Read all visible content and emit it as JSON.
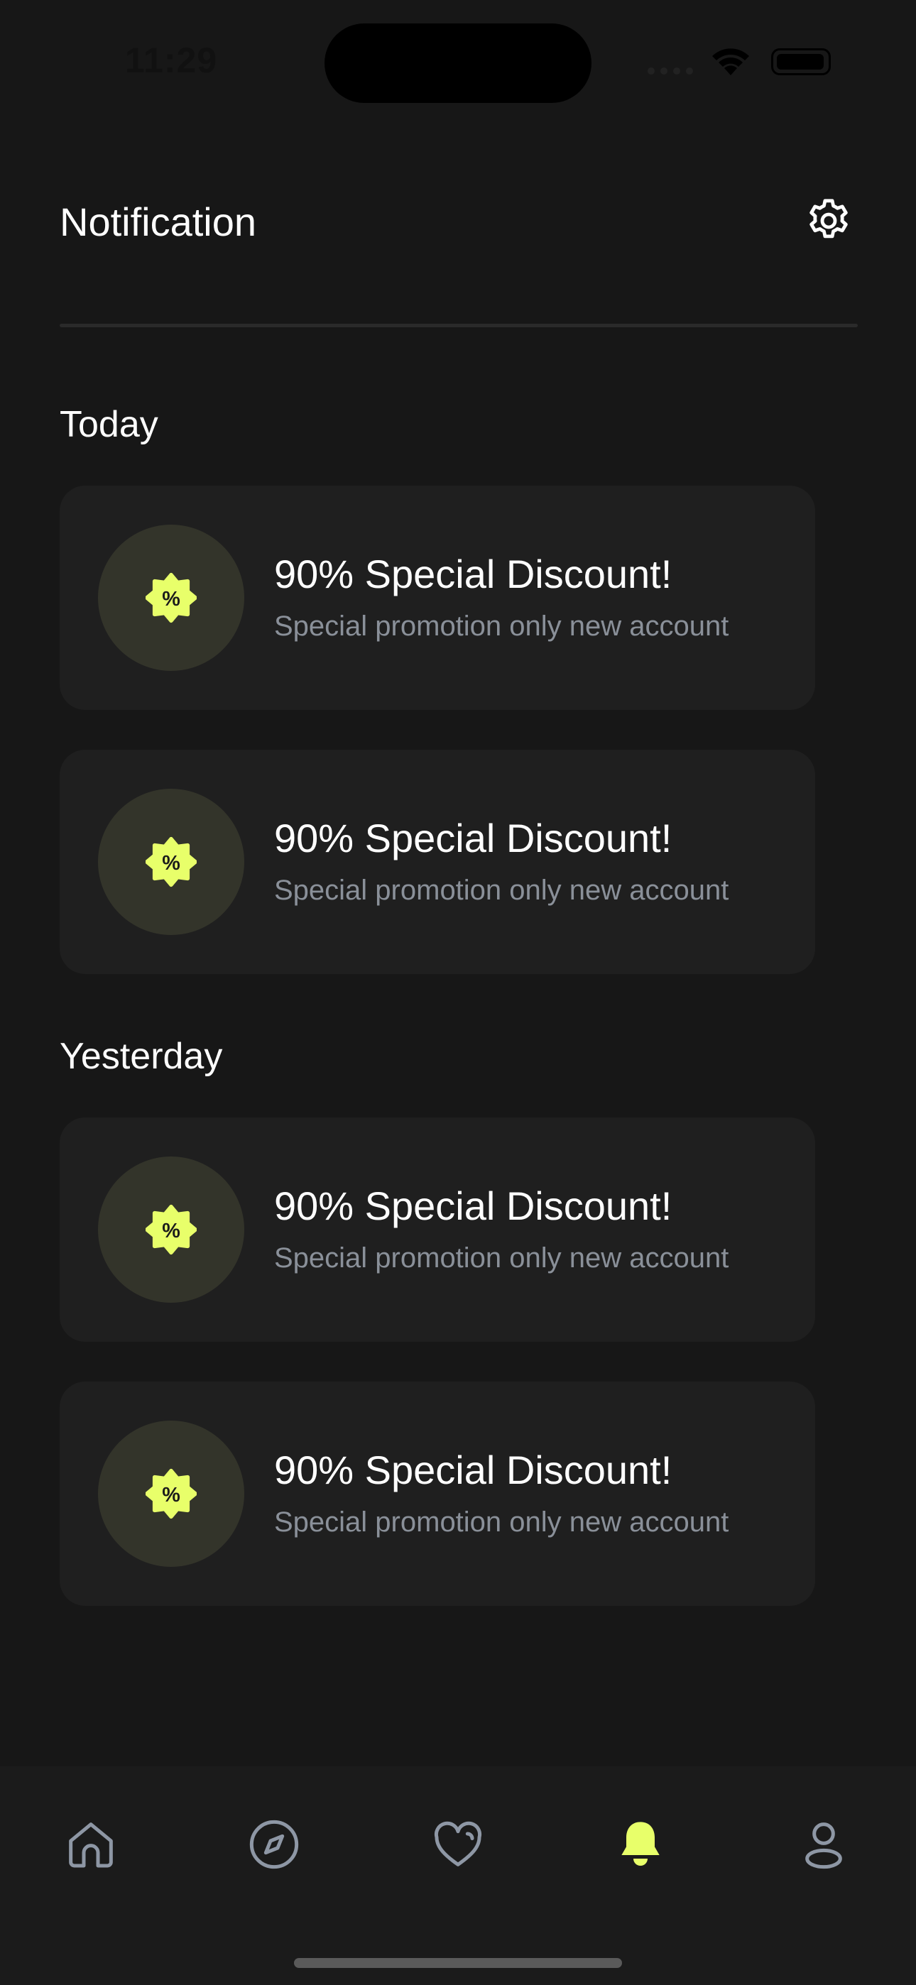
{
  "status_bar": {
    "time": "11:29"
  },
  "header": {
    "title": "Notification"
  },
  "sections": [
    {
      "label": "Today",
      "notifications": [
        {
          "title": "90% Special Discount!",
          "subtitle": "Special promotion only new account",
          "icon": "discount-badge-icon"
        },
        {
          "title": "90% Special Discount!",
          "subtitle": "Special promotion only new account",
          "icon": "discount-badge-icon"
        }
      ]
    },
    {
      "label": "Yesterday",
      "notifications": [
        {
          "title": "90% Special Discount!",
          "subtitle": "Special promotion only new account",
          "icon": "discount-badge-icon"
        },
        {
          "title": "90% Special Discount!",
          "subtitle": "Special promotion only new account",
          "icon": "discount-badge-icon"
        }
      ]
    }
  ],
  "bottom_nav": [
    {
      "icon": "home-icon",
      "active": false
    },
    {
      "icon": "compass-icon",
      "active": false
    },
    {
      "icon": "heart-icon",
      "active": false
    },
    {
      "icon": "bell-icon",
      "active": true
    },
    {
      "icon": "user-icon",
      "active": false
    }
  ],
  "colors": {
    "background": "#171717",
    "card": "#1f1f1f",
    "accent": "#e8ff6a",
    "icon_circle": "#33342a",
    "muted_text": "#8a9099",
    "inactive_icon": "#8e97a5"
  }
}
